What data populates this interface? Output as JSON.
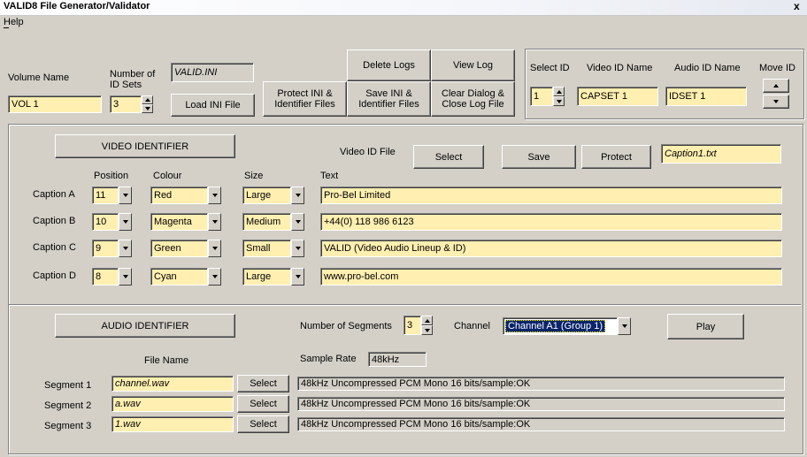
{
  "window": {
    "title": "VALID8 File Generator/Validator",
    "close": "x"
  },
  "menu": {
    "help": "Help"
  },
  "volume": {
    "name_label": "Volume Name",
    "name_value": "VOL 1",
    "id_sets_label_1": "Number of",
    "id_sets_label_2": "ID Sets",
    "id_sets_value": "3",
    "ini_name": "VALID.INI",
    "load_ini": "Load INI File"
  },
  "actions": {
    "delete_logs": "Delete Logs",
    "view_log": "View Log",
    "protect_1": "Protect INI &",
    "protect_2": "Identifier Files",
    "save_1": "Save INI &",
    "save_2": "Identifier Files",
    "clear_1": "Clear Dialog &",
    "clear_2": "Close Log File"
  },
  "id_select": {
    "select_label": "Select ID",
    "select_value": "1",
    "video_label": "Video ID Name",
    "video_value": "CAPSET 1",
    "audio_label": "Audio ID Name",
    "audio_value": "IDSET 1",
    "move_label": "Move ID"
  },
  "video": {
    "header": "VIDEO IDENTIFIER",
    "file_label": "Video ID File",
    "select": "Select",
    "save": "Save",
    "protect": "Protect",
    "file_value": "Caption1.txt",
    "col_position": "Position",
    "col_colour": "Colour",
    "col_size": "Size",
    "col_text": "Text",
    "captions": [
      {
        "label": "Caption A",
        "position": "11",
        "colour": "Red",
        "size": "Large",
        "text": "Pro-Bel Limited"
      },
      {
        "label": "Caption B",
        "position": "10",
        "colour": "Magenta",
        "size": "Medium",
        "text": "+44(0) 118 986 6123"
      },
      {
        "label": "Caption C",
        "position": "9",
        "colour": "Green",
        "size": "Small",
        "text": "VALID (Video Audio Lineup & ID)"
      },
      {
        "label": "Caption D",
        "position": "8",
        "colour": "Cyan",
        "size": "Large",
        "text": "www.pro-bel.com"
      }
    ]
  },
  "audio": {
    "header": "AUDIO IDENTIFIER",
    "segments_label": "Number of Segments",
    "segments_value": "3",
    "channel_label": "Channel",
    "channel_value": "Channel A1 (Group 1)",
    "play": "Play",
    "file_name_label": "File Name",
    "sample_rate_label": "Sample Rate",
    "sample_rate_value": "48kHz",
    "segments": [
      {
        "label": "Segment 1",
        "file": "channel.wav",
        "select": "Select",
        "status": "48kHz Uncompressed PCM Mono 16 bits/sample:OK"
      },
      {
        "label": "Segment 2",
        "file": "a.wav",
        "select": "Select",
        "status": "48kHz Uncompressed PCM Mono 16 bits/sample:OK"
      },
      {
        "label": "Segment 3",
        "file": "1.wav",
        "select": "Select",
        "status": "48kHz Uncompressed PCM Mono 16 bits/sample:OK"
      }
    ]
  }
}
